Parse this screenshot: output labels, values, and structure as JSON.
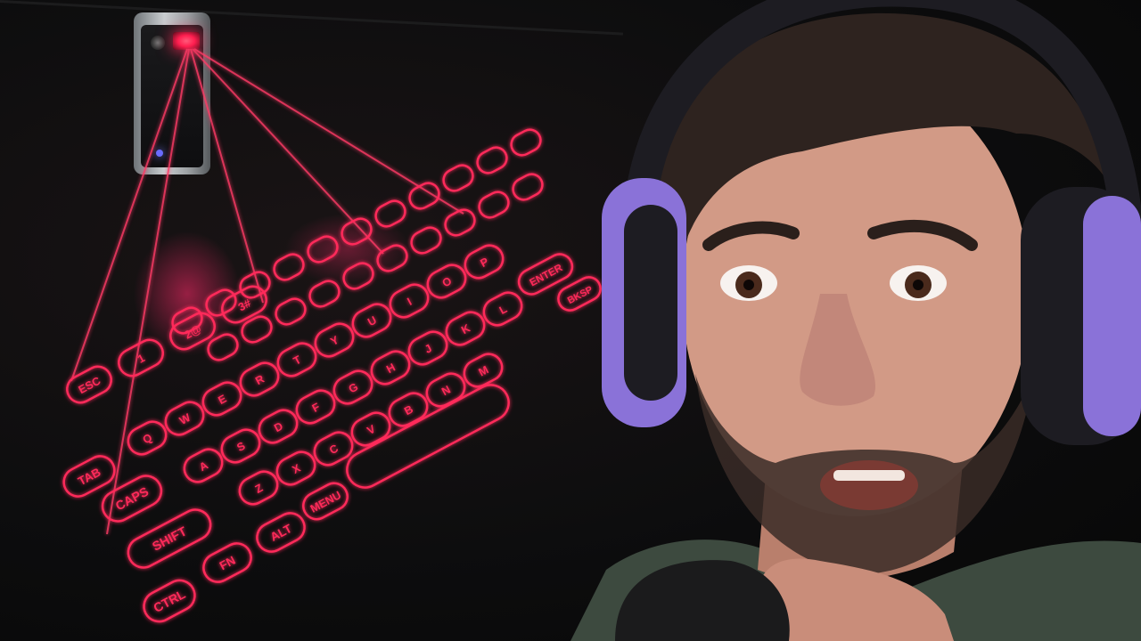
{
  "scene": {
    "description_tags": [
      "laser-projection-keyboard",
      "reaction-face"
    ],
    "laser_color": "#ff2a5a",
    "background_color": "#0b0b0c"
  },
  "keyboard": {
    "row_escape": [
      "ESC",
      "1",
      "2@",
      "3#"
    ],
    "row_q": [
      "Q",
      "W",
      "E",
      "R",
      "T",
      "Y",
      "U",
      "I",
      "O",
      "P"
    ],
    "row_a": [
      "A",
      "S",
      "D",
      "F",
      "G",
      "H",
      "J",
      "K",
      "L"
    ],
    "row_z": [
      "Z",
      "X",
      "C",
      "V",
      "B",
      "N",
      "M"
    ],
    "left_keys": [
      "TAB",
      "CAPS",
      "SHIFT",
      "CTRL"
    ],
    "bottom_keys": [
      "FN",
      "ALT",
      "MENU"
    ],
    "right_keys": [
      "ENTER",
      "BKSP"
    ]
  },
  "person": {
    "headphone_color": "#8a72d8",
    "shirt_color": "#3d4a3f",
    "skin_color": "#d29a86",
    "hair_color": "#2e231f",
    "mic_color": "#1b1b1c"
  }
}
